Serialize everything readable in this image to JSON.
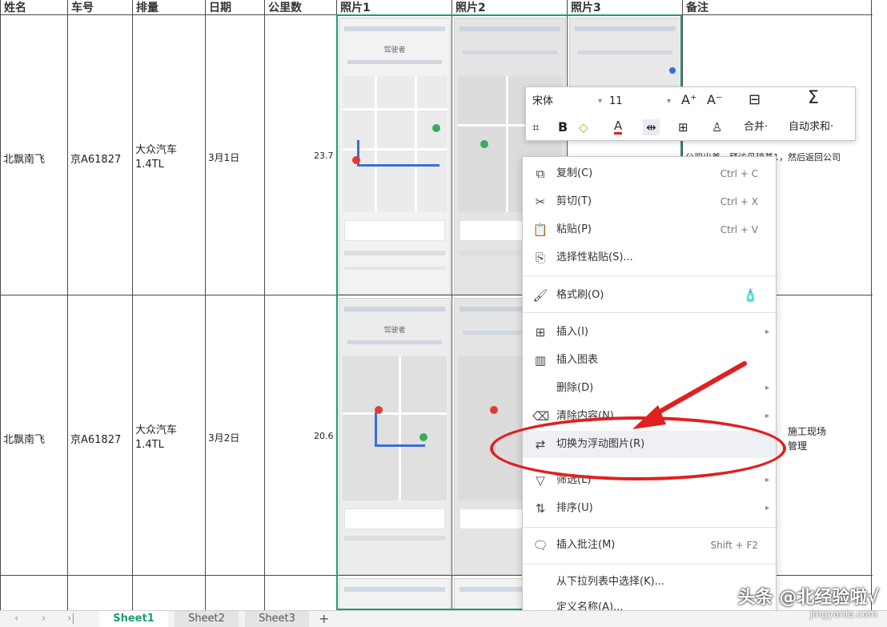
{
  "table": {
    "headers": [
      "姓名",
      "车号",
      "排量",
      "日期",
      "公里数",
      "照片1",
      "照片2",
      "照片3",
      "备注"
    ],
    "rows": [
      {
        "name": "北飘南飞",
        "plate": "京A61827",
        "car_line1": "大众汽车",
        "car_line2": "1.4TL",
        "date": "3月1日",
        "km": "23.7"
      },
      {
        "name": "北飘南飞",
        "plate": "京A61827",
        "car_line1": "大众汽车",
        "car_line2": "1.4TL",
        "date": "3月2日",
        "km": "20.6"
      }
    ],
    "note_row1": "公司出差，拜访丹琼基1，然后返回公司",
    "note_row2_line1": "施工现场",
    "note_row2_line2": "管理",
    "photo_title": "驾驶者"
  },
  "toolbar": {
    "font_name": "宋体",
    "font_size": "11",
    "grow_font": "A⁺",
    "shrink_font": "A⁻",
    "merge_label": "合并·",
    "autosum_label": "自动求和·",
    "bold": "B",
    "font_color": "A"
  },
  "menu": {
    "items": [
      {
        "icon": "⧉",
        "label": "复制(C)",
        "shortcut": "Ctrl + C"
      },
      {
        "icon": "✂",
        "label": "剪切(T)",
        "shortcut": "Ctrl + X"
      },
      {
        "icon": "📋",
        "label": "粘贴(P)",
        "shortcut": "Ctrl + V"
      },
      {
        "icon": "⎘",
        "label": "选择性粘贴(S)...",
        "shortcut": ""
      },
      {
        "icon": "🖌",
        "label": "格式刷(O)",
        "shortcut": ""
      },
      {
        "icon": "⊞",
        "label": "插入(I)",
        "shortcut": ""
      },
      {
        "icon": "▥",
        "label": "插入图表",
        "shortcut": ""
      },
      {
        "icon": "",
        "label": "删除(D)",
        "shortcut": ""
      },
      {
        "icon": "⌫",
        "label": "清除内容(N)",
        "shortcut": ""
      },
      {
        "icon": "⇄",
        "label": "切换为浮动图片(R)",
        "shortcut": ""
      },
      {
        "icon": "▽",
        "label": "筛选(L)",
        "shortcut": ""
      },
      {
        "icon": "⇅",
        "label": "排序(U)",
        "shortcut": ""
      },
      {
        "icon": "🗨",
        "label": "插入批注(M)",
        "shortcut": "Shift + F2"
      },
      {
        "icon": "",
        "label": "从下拉列表中选择(K)...",
        "shortcut": ""
      },
      {
        "icon": "",
        "label": "定义名称(A)...",
        "shortcut": ""
      }
    ]
  },
  "sheets": {
    "tabs": [
      "Sheet1",
      "Sheet2",
      "Sheet3"
    ],
    "active": "Sheet1",
    "add": "+"
  },
  "watermark": {
    "line1": "头条 @北经验啦√",
    "line2": "jingyanla.com"
  },
  "colors": {
    "accent": "#1a9e74",
    "highlight": "#e02020",
    "route": "#3a6fd0"
  }
}
